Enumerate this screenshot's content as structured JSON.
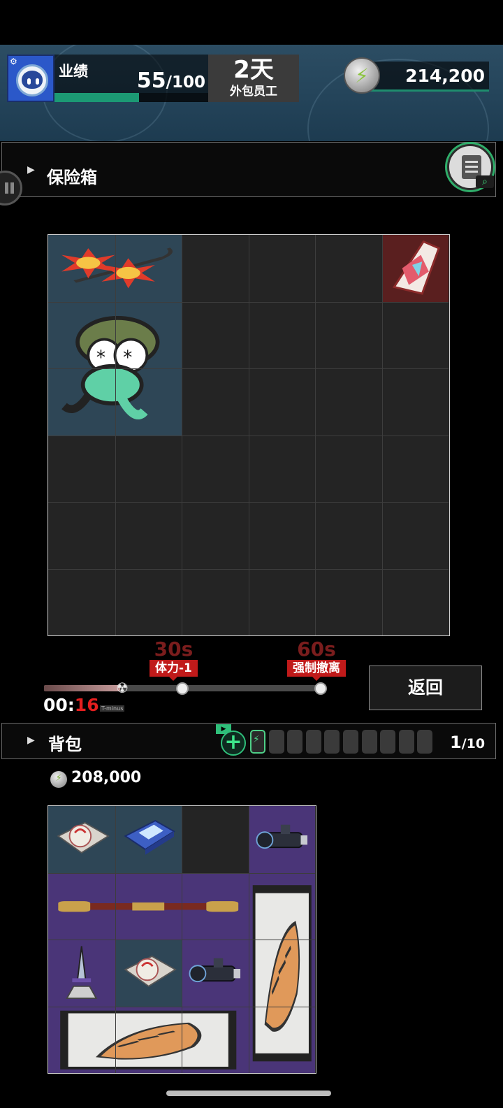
{
  "header": {
    "perf_label": "业绩",
    "perf_value": "55",
    "perf_max": "/100",
    "perf_progress": 0.55,
    "days_value": "2天",
    "days_label": "外包员工",
    "currency_value": "214,200"
  },
  "safe": {
    "title": "保险箱",
    "grid": {
      "cols": 6,
      "rows": 6
    },
    "items": [
      {
        "name": "sun-flail-item",
        "icon": "sun-morningstar",
        "col": 0,
        "row": 0,
        "w": 2,
        "h": 1,
        "bg": "#2e4656"
      },
      {
        "name": "crystal-item",
        "icon": "prism-crystal",
        "col": 5,
        "row": 0,
        "w": 1,
        "h": 1,
        "bg": "#5a1f1f"
      },
      {
        "name": "frog-soldier-item",
        "icon": "frog-soldier",
        "col": 0,
        "row": 1,
        "w": 2,
        "h": 2,
        "bg": "#2e4656"
      }
    ]
  },
  "timer": {
    "marker1_sec": "30s",
    "marker1_tag": "体力-1",
    "marker2_sec": "60s",
    "marker2_tag": "强制撤离",
    "elapsed_prefix": "00:",
    "elapsed_seconds": "16",
    "tminus_label": "T-minus",
    "progress": 0.27,
    "max_seconds": 60,
    "return_label": "返回"
  },
  "bag": {
    "title": "背包",
    "count": "1",
    "count_max": "/10",
    "batteries_on": 1,
    "batteries_total": 10,
    "money": "208,000",
    "grid": {
      "cols": 4,
      "rows": 4
    },
    "items": [
      {
        "name": "gift-box-item",
        "icon": "gift-box",
        "col": 0,
        "row": 0,
        "w": 1,
        "h": 1,
        "bg": "#2e4656"
      },
      {
        "name": "handheld-device-item",
        "icon": "handheld-device",
        "col": 1,
        "row": 0,
        "w": 1,
        "h": 1,
        "bg": "#2e4656"
      },
      {
        "name": "scope-item-1",
        "icon": "rifle-scope",
        "col": 3,
        "row": 0,
        "w": 1,
        "h": 1,
        "bg": "#4a3578"
      },
      {
        "name": "golden-staff-item",
        "icon": "golden-staff",
        "col": 0,
        "row": 1,
        "w": 3,
        "h": 1,
        "bg": "#4a3578"
      },
      {
        "name": "tiger-scroll-vertical-item",
        "icon": "tiger-scroll",
        "col": 3,
        "row": 1,
        "w": 1,
        "h": 3,
        "bg": "#4a3578"
      },
      {
        "name": "sword-statue-item",
        "icon": "sword-statue",
        "col": 0,
        "row": 2,
        "w": 1,
        "h": 1,
        "bg": "#4a3578"
      },
      {
        "name": "gift-box-item-2",
        "icon": "gift-box",
        "col": 1,
        "row": 2,
        "w": 1,
        "h": 1,
        "bg": "#2e4656"
      },
      {
        "name": "scope-item-2",
        "icon": "rifle-scope",
        "col": 2,
        "row": 2,
        "w": 1,
        "h": 1,
        "bg": "#4a3578"
      },
      {
        "name": "tiger-scroll-horizontal-item",
        "icon": "tiger-scroll",
        "col": 0,
        "row": 3,
        "w": 3,
        "h": 1,
        "bg": "#4a3578"
      }
    ]
  },
  "colors": {
    "accent_green": "#2fbf7a",
    "danger_red": "#c01a1a",
    "rare_purple": "#4a3578",
    "common_blue": "#2e4656"
  }
}
